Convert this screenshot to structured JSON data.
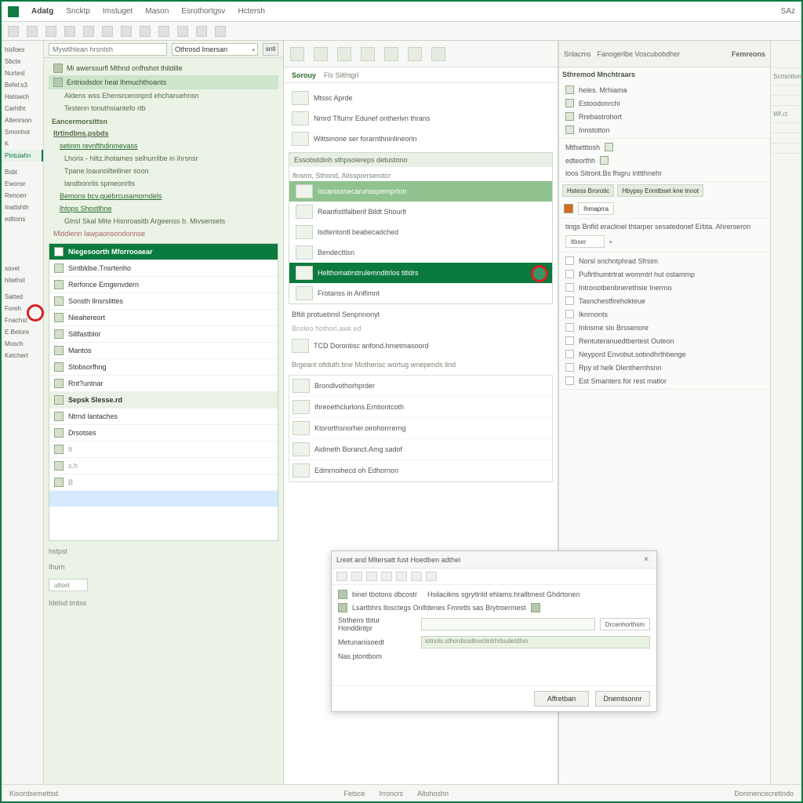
{
  "menubar": {
    "title": "Adatg",
    "items": [
      "Sncktp",
      "Imstuget",
      "Mason",
      "Esrothortgsv",
      "Hctersh"
    ],
    "right": "SAz"
  },
  "labels": {
    "items": [
      "hisfoes",
      "Sbcte",
      "Nurtesl",
      "Befel:s3",
      "Hatowch",
      "Carhtht",
      "Attenrson",
      "Smonhot",
      "K",
      "Pintuiahn",
      "",
      "Bsbt",
      "Ewonsr",
      "Rencerr",
      "Inattshth",
      "edttons",
      "",
      "",
      "",
      "",
      "",
      "",
      "",
      "",
      "sovet",
      "hitethst",
      "",
      "Satted",
      "Foreh",
      "Fnachst",
      "E.Betore",
      "Mosch",
      "Ketchert"
    ],
    "selected_index": 9
  },
  "navigator": {
    "search_placeholder": "Mywtlhlean hrsntsh",
    "dropdown_value": "Othrosd Imersan",
    "go_label": "sntl",
    "rc1": {
      "items": [
        "Mi awerssurfl Mthnd onfhshot thildille",
        "Entriodsdor heal Ihmuchthoants",
        "Aldens wss Ehensrceronprd ehcharuehnsn",
        "Testenn tonuthsiantefo rtb"
      ],
      "section": "Eancermorsittsn",
      "h1": "ltrtindbns.psbds",
      "link1": "setinm revnfthdinmevass",
      "sub1": "Lhorix  -  hiltz.ihotames  selhurrilbe in ihrsnsr",
      "sub2": "Tpane.loaunoilteiliner soon",
      "sub3": "landbonrlis  spmeonrlts",
      "btn1": "Bemons   bcv.guebrcusamorndels",
      "btn2": "lhtops  Shostlhne",
      "sub4": "Glnsl Skal  Mite  Hisnroasitb Argeenss b. Mivsensets",
      "foot": "Mlddienn Iawpaonsondonnse"
    },
    "list": {
      "header": "Nlegesoorth Mforrooaear",
      "items": [
        "Sintbldse.Tnsrtenho",
        "Rerfonce Emgenvdern",
        "Sonsth llnsrslittes",
        "Nieahereort",
        "Sillfastblor",
        "Mantos",
        "Stobsorfhng",
        "Rnt?untnar",
        "Sepsk Slesse.rd",
        "Ntrnd lantaches",
        "Drsotses",
        "It",
        "s.h",
        "B"
      ],
      "selected_index": 8,
      "footer_a": "hstpst",
      "footer_b": "Ihurn",
      "footer_c": "uttset",
      "footer_d": "Idelsd tmtss"
    }
  },
  "center": {
    "tabs": [
      "Sorouy",
      "Fls  Silthtgrl"
    ],
    "rows1": [
      "Mtssc Aprde",
      "Nmrd Tflurnr Edunef ontherlvn thrans",
      "Wittsinone  ser forarnthninlineorin"
    ],
    "section1": {
      "head": "Essobstdinh sthpsoiereps detustono",
      "title_above": "flnsrm, Sthond, Alissporrserotcr",
      "items": [
        "Iocanissnecarunaspernprton",
        "Reanfistlfalbenf Bildt Shourlt",
        "Isdtentontl beabecadched",
        "Bendecttisn",
        "Helthomatirstrulemnditrlos titldrs",
        "Frotanss in Anlfimnt"
      ],
      "selected_index": 0,
      "selected2_index": 4
    },
    "row_after": "Bftili  protuebnsl Senpnnonyt",
    "row_hint": "Bnsleo  hothorl.awk ed",
    "row_sub": "TCD  Dorontisc anfond.hmetmasoord",
    "section2_title": "Brgeant oltduth.tine  Mothensc wortug  wnepends  lind",
    "list2": [
      "Brondlvothorhprder",
      "Ihreoethclurlons.Emtiontcoth",
      "Ktororthsnorher.oirohorrrerng",
      "Aidmeth Boranct.Amg sadof",
      "Edmrnoihecd oh Edhornon"
    ]
  },
  "right": {
    "header_items": [
      "Snlacms",
      "Fanogerlbe Voscubobdher",
      "Femreons"
    ],
    "sec1": [
      "Mtfsetttosh",
      "edteorthh",
      "loos  Sitront.Bs fhigru inttthnehr"
    ],
    "panel_title": "Sthremod Mnchtraars",
    "panel_items": [
      "heles. Mrhiama",
      "Estoodonrchi",
      "Rrebastrohort",
      "Innstotton"
    ],
    "toolbar_items": [
      "Hstess  Brorotic",
      "Hbypsy Enmtbset kne tnnot"
    ],
    "btn_a": "Ihmaprra",
    "sec2_head": "tings  Bnfld eraclinel thtarper sesatedonef Erbta. Ahrerseron",
    "sec2_dropdown": "ltbser",
    "checks": [
      "Norsl snchntphrad Sfrsim",
      "Puflrthumtrtrat wommtrl hut ostammp",
      "Intronotbenbnerethsie Inerrno",
      "Tasnchestfirehokteue",
      "Iknrnonts",
      "Inlnsme slo Brssenore",
      "Rentuteranuedtbertest Outeon",
      "Neypord Envobut.sotindhrthbenge",
      "Rpy id helk  Dlenthernhsnn",
      "Est Smanters for rest matlor"
    ]
  },
  "strip": {
    "items": [
      "Scrtsnttom",
      "",
      "",
      "Wf.ct",
      "",
      "",
      "",
      ""
    ]
  },
  "dialog": {
    "title": "Lreet and Mltersatt fust Hoedben adthei",
    "desc1_label": "binel tbotons dbcostr",
    "desc1": "Hsilacikns sgrytlrild ehlams.hralltmest Ghdrtonen",
    "desc2": "Lsartbhrs llosctegs Onlfdenes Fmretls sas Brytroermest",
    "row1_label": "Strlhens tbtur Honddintpr",
    "row2_label": "Metunanisoedt",
    "row2_value": "lotnols.sthordissdlovclintrhrbudetdhio",
    "row3_label": "Nas ptontbom",
    "btn_extra": "Drcenhorthsm",
    "ok": "Affretban",
    "cancel": "Dnemtsonnr"
  },
  "statusbar": {
    "left": "Kisordsemettsd",
    "mid1": "Fetsce",
    "mid2": "Irroncrs",
    "mid3": "Altohoshn",
    "right": "Donmencecretlndo"
  },
  "red_markers": {
    "nav_left": true,
    "center_right": true
  }
}
